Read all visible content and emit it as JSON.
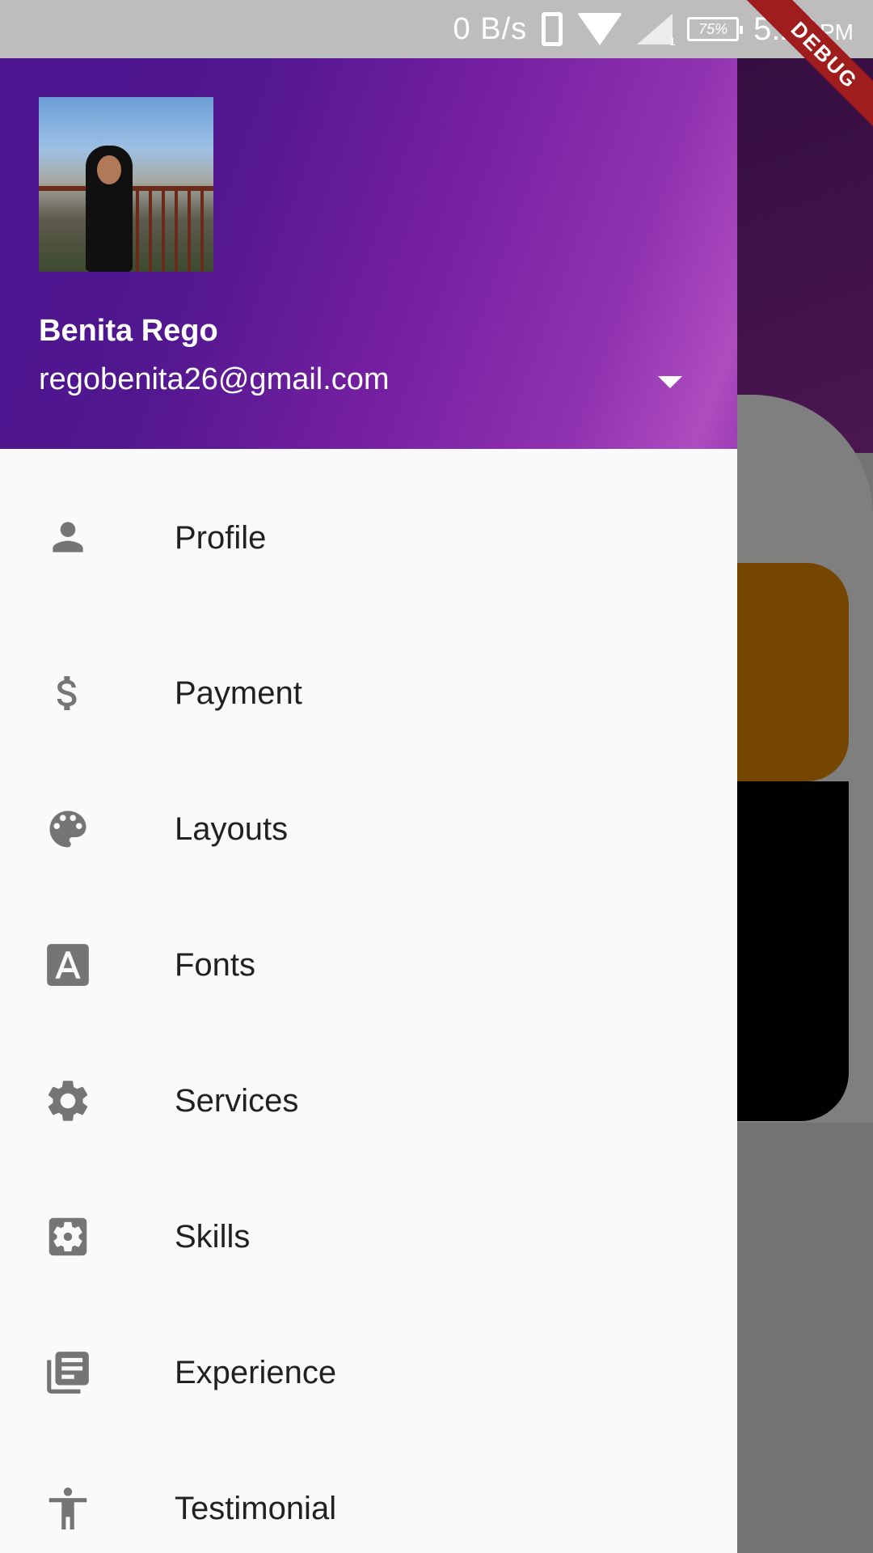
{
  "status_bar": {
    "net_speed": "0 B/s",
    "signal_sub": "1",
    "battery": "75%",
    "time": "5:29",
    "time_suffix": "PM"
  },
  "debug_banner": "DEBUG",
  "drawer": {
    "user": {
      "name": "Benita Rego",
      "email": "regobenita26@gmail.com"
    },
    "items": [
      {
        "label": "Profile",
        "icon": "person-icon"
      },
      {
        "label": "Payment",
        "icon": "dollar-icon"
      },
      {
        "label": "Layouts",
        "icon": "palette-icon"
      },
      {
        "label": "Fonts",
        "icon": "font-icon"
      },
      {
        "label": "Services",
        "icon": "gear-icon"
      },
      {
        "label": "Skills",
        "icon": "settings-box-icon"
      },
      {
        "label": "Experience",
        "icon": "library-books-icon"
      },
      {
        "label": "Testimonial",
        "icon": "accessibility-icon"
      }
    ]
  },
  "colors": {
    "header_gradient_start": "#4b1590",
    "header_gradient_end": "#ae4cbf",
    "icon_grey": "#757575",
    "drawer_bg": "#fafafa"
  }
}
